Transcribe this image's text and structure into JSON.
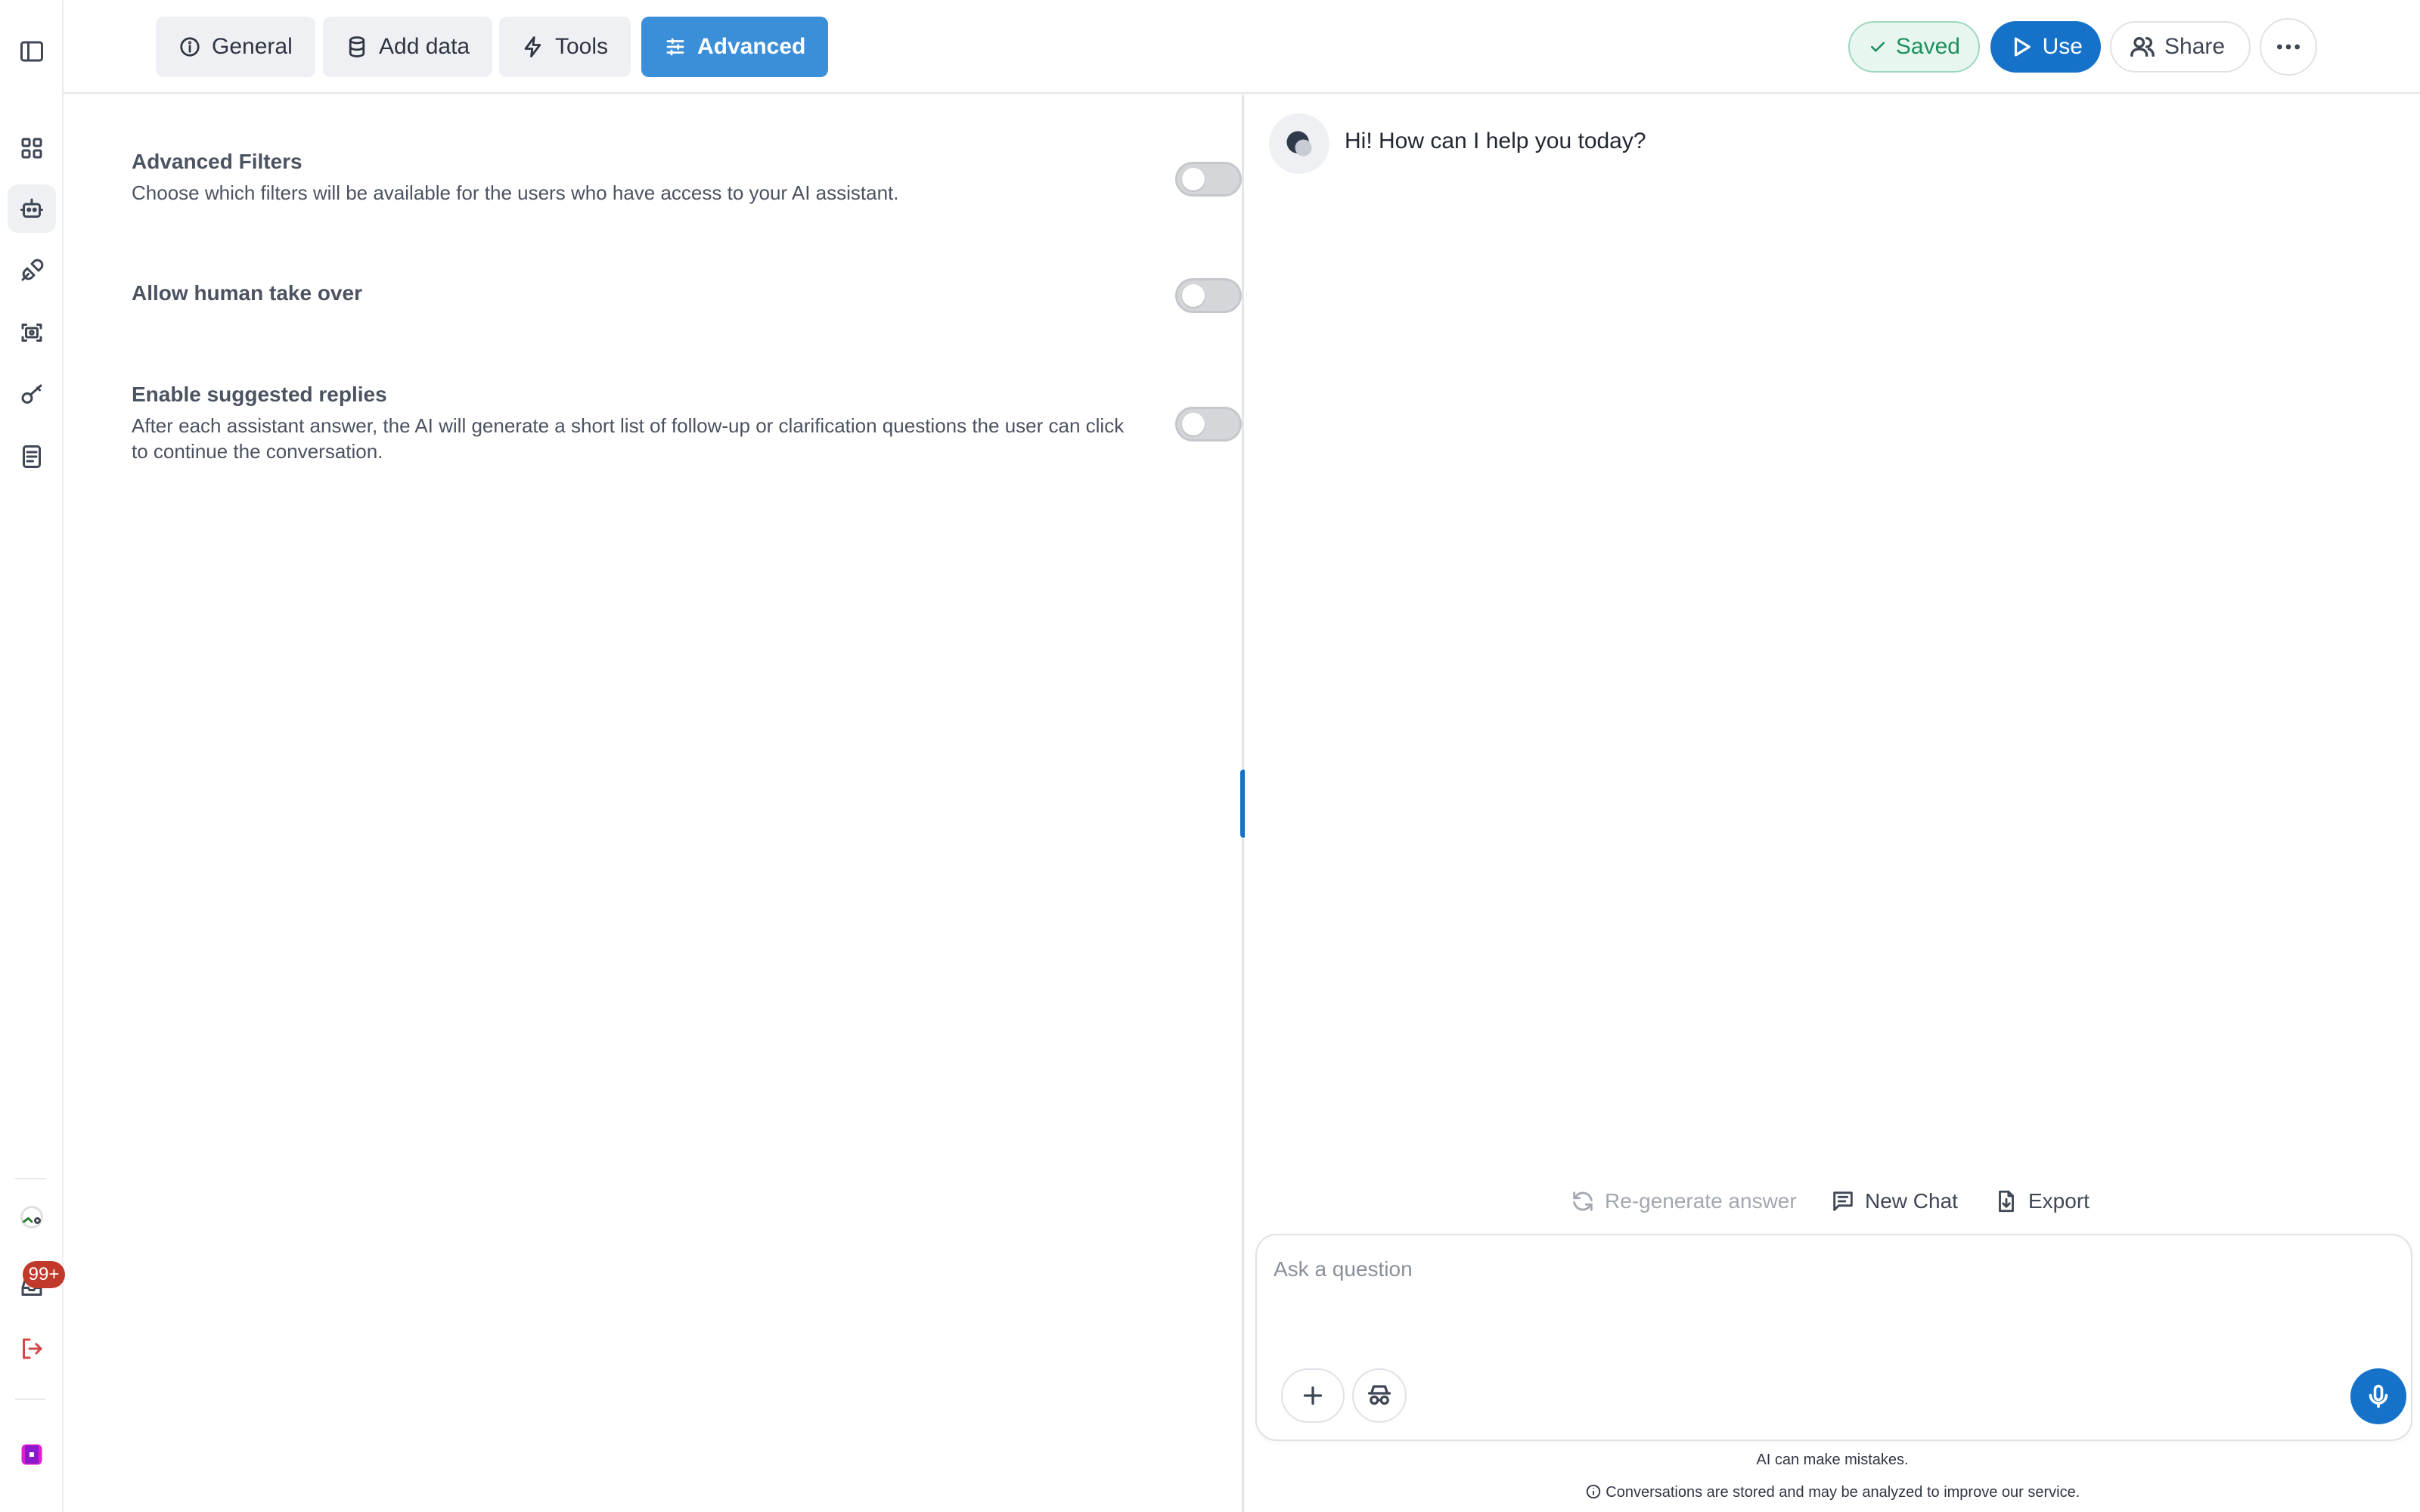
{
  "tabs": [
    {
      "label": "General",
      "icon": "info-icon"
    },
    {
      "label": "Add data",
      "icon": "database-icon"
    },
    {
      "label": "Tools",
      "icon": "lightning-icon"
    },
    {
      "label": "Advanced",
      "icon": "sliders-icon",
      "active": true
    }
  ],
  "header_actions": {
    "saved_label": "Saved",
    "use_label": "Use",
    "share_label": "Share"
  },
  "settings": [
    {
      "title": "Advanced Filters",
      "description": "Choose which filters will be available for the users who have access to your AI assistant.",
      "enabled": false
    },
    {
      "title": "Allow human take over",
      "description": "",
      "enabled": false
    },
    {
      "title": "Enable suggested replies",
      "description": "After each assistant answer, the AI will generate a short list of follow-up or clarification questions the user can click to continue the conversation.",
      "enabled": false
    }
  ],
  "sidebar": {
    "notification_badge": "99+"
  },
  "chat": {
    "greeting": "Hi! How can I help you today?",
    "regenerate_label": "Re-generate answer",
    "new_chat_label": "New Chat",
    "export_label": "Export",
    "input_placeholder": "Ask a question",
    "disclaimer": "AI can make mistakes.",
    "privacy_note": "Conversations are stored and may be analyzed to improve our service."
  },
  "colors": {
    "accent": "#1672c9",
    "active_tab": "#3b8fd8",
    "saved_green": "#1f8f5f",
    "badge_red": "#c0392b"
  }
}
